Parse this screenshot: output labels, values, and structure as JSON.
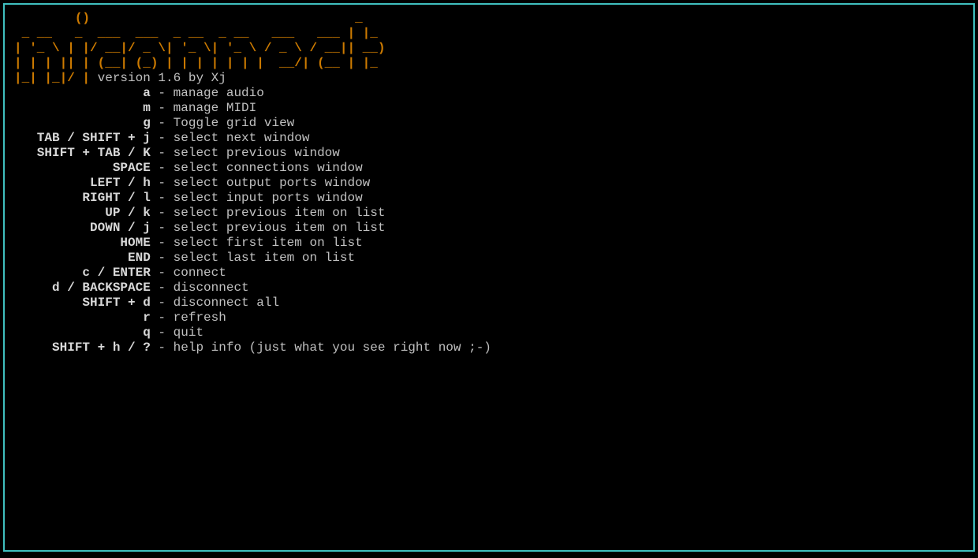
{
  "ascii_logo_lines": [
    "        ()                                   _",
    " _ __   _  ___  ___  _ __  _ __   ___   ___ | |_",
    "| '_ \\ | |/ __|/ _ \\| '_ \\| '_ \\ / _ \\ / __|| __)",
    "| | | || | (__| (_) | | | | | | |  __/| (__ | |_"
  ],
  "logo_tail": "|_| |_|/ |",
  "version_text": " version 1.6 by Xj",
  "help": [
    {
      "key": "a",
      "desc": "manage audio"
    },
    {
      "key": "m",
      "desc": "manage MIDI"
    },
    {
      "key": "g",
      "desc": "Toggle grid view"
    },
    {
      "key": "TAB / SHIFT + j",
      "desc": "select next window"
    },
    {
      "key": "SHIFT + TAB / K",
      "desc": "select previous window"
    },
    {
      "key": "SPACE",
      "desc": "select connections window"
    },
    {
      "key": "LEFT / h",
      "desc": "select output ports window"
    },
    {
      "key": "RIGHT / l",
      "desc": "select input ports window"
    },
    {
      "key": "UP / k",
      "desc": "select previous item on list"
    },
    {
      "key": "DOWN / j",
      "desc": "select previous item on list"
    },
    {
      "key": "HOME",
      "desc": "select first item on list"
    },
    {
      "key": "END",
      "desc": "select last item on list"
    },
    {
      "key": "c / ENTER",
      "desc": "connect"
    },
    {
      "key": "d / BACKSPACE",
      "desc": "disconnect"
    },
    {
      "key": "SHIFT + d",
      "desc": "disconnect all"
    },
    {
      "key": "r",
      "desc": "refresh"
    },
    {
      "key": "q",
      "desc": "quit"
    },
    {
      "key": "SHIFT + h / ?",
      "desc": "help info (just what you see right now ;-)"
    }
  ],
  "key_col_width": 18
}
